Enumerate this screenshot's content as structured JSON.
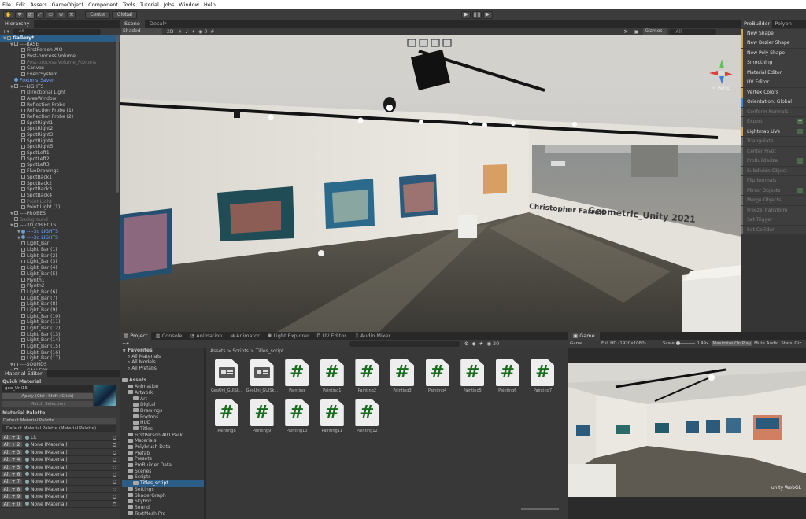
{
  "menu": [
    "File",
    "Edit",
    "Assets",
    "GameObject",
    "Component",
    "Tools",
    "Tutorial",
    "Jobs",
    "Window",
    "Help"
  ],
  "toolbar": {
    "pivot": "Center",
    "space": "Global"
  },
  "hierarchy": {
    "title": "Hierarchy",
    "search": "All",
    "rows": [
      {
        "t": "Gallery*",
        "d": 0,
        "k": "scene"
      },
      {
        "t": "----BASE",
        "d": 1,
        "k": "go"
      },
      {
        "t": "FirstPerson-AIO",
        "d": 2,
        "k": "go"
      },
      {
        "t": "Post-process Volume",
        "d": 2,
        "k": "go"
      },
      {
        "t": "Post-process Volume_Foxtons",
        "d": 2,
        "k": "dim"
      },
      {
        "t": "Canvas",
        "d": 2,
        "k": "go"
      },
      {
        "t": "EventSystem",
        "d": 2,
        "k": "go"
      },
      {
        "t": "Foxtons_Saver",
        "d": 1,
        "k": "blue"
      },
      {
        "t": "----LIGHTS",
        "d": 1,
        "k": "go"
      },
      {
        "t": "Directional Light",
        "d": 2,
        "k": "go"
      },
      {
        "t": "AreaWindow",
        "d": 2,
        "k": "go"
      },
      {
        "t": "Reflection Probe",
        "d": 2,
        "k": "go"
      },
      {
        "t": "Reflection Probe (1)",
        "d": 2,
        "k": "go"
      },
      {
        "t": "Reflection Probe (2)",
        "d": 2,
        "k": "go"
      },
      {
        "t": "SpotRight1",
        "d": 2,
        "k": "go"
      },
      {
        "t": "SpotRight2",
        "d": 2,
        "k": "go"
      },
      {
        "t": "SpotRight3",
        "d": 2,
        "k": "go"
      },
      {
        "t": "SpotRight4",
        "d": 2,
        "k": "go"
      },
      {
        "t": "SpotRight5",
        "d": 2,
        "k": "go"
      },
      {
        "t": "SpotLeft1",
        "d": 2,
        "k": "go"
      },
      {
        "t": "SpotLeft2",
        "d": 2,
        "k": "go"
      },
      {
        "t": "SpotLeft3",
        "d": 2,
        "k": "go"
      },
      {
        "t": "FluoDrawings",
        "d": 2,
        "k": "go"
      },
      {
        "t": "SpotBack1",
        "d": 2,
        "k": "go"
      },
      {
        "t": "SpotBack2",
        "d": 2,
        "k": "go"
      },
      {
        "t": "SpotBack3",
        "d": 2,
        "k": "go"
      },
      {
        "t": "SpotBack4",
        "d": 2,
        "k": "go"
      },
      {
        "t": "Point Light",
        "d": 2,
        "k": "dim"
      },
      {
        "t": "Point Light (1)",
        "d": 2,
        "k": "go"
      },
      {
        "t": "----PROBES",
        "d": 1,
        "k": "go"
      },
      {
        "t": "Background",
        "d": 1,
        "k": "dim"
      },
      {
        "t": "----3D_OBJECTS",
        "d": 1,
        "k": "go"
      },
      {
        "t": "----3d LIGHTS",
        "d": 2,
        "k": "blue"
      },
      {
        "t": "----3d LIGHTS",
        "d": 2,
        "k": "blue"
      },
      {
        "t": "Light_Bar",
        "d": 2,
        "k": "go"
      },
      {
        "t": "Light_Bar (1)",
        "d": 2,
        "k": "go"
      },
      {
        "t": "Light_Bar (2)",
        "d": 2,
        "k": "go"
      },
      {
        "t": "Light_Bar (3)",
        "d": 2,
        "k": "go"
      },
      {
        "t": "Light_Bar (4)",
        "d": 2,
        "k": "go"
      },
      {
        "t": "Light_Bar (5)",
        "d": 2,
        "k": "go"
      },
      {
        "t": "Plynth1",
        "d": 2,
        "k": "go"
      },
      {
        "t": "Plynth2",
        "d": 2,
        "k": "go"
      },
      {
        "t": "Light_Bar (6)",
        "d": 2,
        "k": "go"
      },
      {
        "t": "Light_Bar (7)",
        "d": 2,
        "k": "go"
      },
      {
        "t": "Light_Bar (8)",
        "d": 2,
        "k": "go"
      },
      {
        "t": "Light_Bar (9)",
        "d": 2,
        "k": "go"
      },
      {
        "t": "Light_Bar (10)",
        "d": 2,
        "k": "go"
      },
      {
        "t": "Light_Bar (11)",
        "d": 2,
        "k": "go"
      },
      {
        "t": "Light_Bar (12)",
        "d": 2,
        "k": "go"
      },
      {
        "t": "Light_Bar (13)",
        "d": 2,
        "k": "go"
      },
      {
        "t": "Light_Bar (14)",
        "d": 2,
        "k": "go"
      },
      {
        "t": "Light_Bar (15)",
        "d": 2,
        "k": "go"
      },
      {
        "t": "Light_Bar (16)",
        "d": 2,
        "k": "go"
      },
      {
        "t": "Light_Bar (17)",
        "d": 2,
        "k": "go"
      },
      {
        "t": "----SOUNDS",
        "d": 1,
        "k": "go"
      },
      {
        "t": "----GALLERY",
        "d": 1,
        "k": "go"
      }
    ]
  },
  "material_editor": {
    "title": "Material Editor",
    "quick": "Quick Material",
    "mat": "geo_Uni15",
    "apply": "Apply (Ctrl+Shift+Click)",
    "match": "Match Selection",
    "palette": "Material Palette",
    "palette_sel": "Default Material Palette",
    "palette_name": "Default Material Palette (Material Palette)",
    "rows": [
      {
        "alt": "Alt + 1",
        "name": "Lit"
      },
      {
        "alt": "Alt + 2",
        "name": "None (Material)"
      },
      {
        "alt": "Alt + 3",
        "name": "None (Material)"
      },
      {
        "alt": "Alt + 4",
        "name": "None (Material)"
      },
      {
        "alt": "Alt + 5",
        "name": "None (Material)"
      },
      {
        "alt": "Alt + 6",
        "name": "None (Material)"
      },
      {
        "alt": "Alt + 7",
        "name": "None (Material)"
      },
      {
        "alt": "Alt + 8",
        "name": "None (Material)"
      },
      {
        "alt": "Alt + 9",
        "name": "None (Material)"
      },
      {
        "alt": "Alt + 0",
        "name": "None (Material)"
      }
    ]
  },
  "scene": {
    "tab1": "Scene",
    "tab2": "Decal*",
    "shading": "Shaded",
    "mode2d": "2D",
    "gizmos": "Gizmos",
    "search": "All",
    "persp": "< Persp",
    "count": "0",
    "watermark1": "Christopher Farrell",
    "watermark2": "Geometric_Unity 2021"
  },
  "probuilder": {
    "tab1": "ProBuilder",
    "tab2": "Polybn",
    "items": [
      {
        "t": "New Shape",
        "s": "n"
      },
      {
        "t": "New Bezier Shape",
        "s": "n"
      },
      {
        "t": "New Poly Shape",
        "s": "n"
      },
      {
        "t": "Smoothing",
        "s": "n"
      },
      {
        "t": "Material Editor",
        "s": "n"
      },
      {
        "t": "UV Editor",
        "s": "n"
      },
      {
        "t": "Vertex Colors",
        "s": "n"
      },
      {
        "t": "Orientation: Global",
        "s": "b"
      },
      {
        "t": "Conform Normals",
        "s": "d"
      },
      {
        "t": "Export",
        "s": "d",
        "p": 1
      },
      {
        "t": "Lightmap UVs",
        "s": "n",
        "p": 1
      },
      {
        "t": "Triangulate",
        "s": "d"
      },
      {
        "t": "Center Pivot",
        "s": "d"
      },
      {
        "t": "ProBuilderize",
        "s": "d",
        "p": 1
      },
      {
        "t": "Subdivide Object",
        "s": "d"
      },
      {
        "t": "Flip Normals",
        "s": "d"
      },
      {
        "t": "Mirror Objects",
        "s": "d",
        "p": 1
      },
      {
        "t": "Merge Objects",
        "s": "d"
      },
      {
        "t": "Freeze Transform",
        "s": "d"
      },
      {
        "t": "Set Trigger",
        "s": "d"
      },
      {
        "t": "Set Collider",
        "s": "d"
      }
    ]
  },
  "project": {
    "tabs": [
      "Project",
      "Console",
      "Animation",
      "Animator",
      "Light Explorer",
      "UV Editor",
      "Audio Mixer"
    ],
    "path": [
      "Assets",
      ">",
      "Scripts",
      ">",
      "Titles_script"
    ],
    "count": "20",
    "tree": [
      {
        "t": "Favorites",
        "d": 0,
        "k": "star"
      },
      {
        "t": "All Materials",
        "d": 1,
        "k": "search"
      },
      {
        "t": "All Models",
        "d": 1,
        "k": "search"
      },
      {
        "t": "All Prefabs",
        "d": 1,
        "k": "search"
      },
      {
        "t": "",
        "d": 0,
        "k": "gap"
      },
      {
        "t": "Assets",
        "d": 0,
        "k": "folder"
      },
      {
        "t": "Animation",
        "d": 1,
        "k": "folder"
      },
      {
        "t": "Artwork",
        "d": 1,
        "k": "folder"
      },
      {
        "t": "Art",
        "d": 2,
        "k": "folder"
      },
      {
        "t": "Digital",
        "d": 2,
        "k": "folder"
      },
      {
        "t": "Drawings",
        "d": 2,
        "k": "folder"
      },
      {
        "t": "Foxtons",
        "d": 2,
        "k": "folder"
      },
      {
        "t": "HUD",
        "d": 2,
        "k": "folder"
      },
      {
        "t": "Titles",
        "d": 2,
        "k": "folder"
      },
      {
        "t": "FirstPerson AIO Pack",
        "d": 1,
        "k": "folder"
      },
      {
        "t": "Materials",
        "d": 1,
        "k": "folder"
      },
      {
        "t": "Polybrush Data",
        "d": 1,
        "k": "folder"
      },
      {
        "t": "Prefab",
        "d": 1,
        "k": "folder"
      },
      {
        "t": "Presets",
        "d": 1,
        "k": "folder"
      },
      {
        "t": "ProBuilder Data",
        "d": 1,
        "k": "folder"
      },
      {
        "t": "Scenes",
        "d": 1,
        "k": "folder"
      },
      {
        "t": "Scripts",
        "d": 1,
        "k": "folder"
      },
      {
        "t": "Titles_script",
        "d": 2,
        "k": "sel"
      },
      {
        "t": "Settings",
        "d": 1,
        "k": "folder"
      },
      {
        "t": "ShaderGraph",
        "d": 1,
        "k": "folder"
      },
      {
        "t": "Skybox",
        "d": 1,
        "k": "folder"
      },
      {
        "t": "Sound",
        "d": 1,
        "k": "folder"
      },
      {
        "t": "TextMesh Pro",
        "d": 1,
        "k": "folder"
      }
    ],
    "assets": [
      {
        "t": "GeoUni_GUISk...",
        "g": 1
      },
      {
        "t": "GeoUni_GUISk...",
        "g": 1
      },
      {
        "t": "Painting"
      },
      {
        "t": "Painting1"
      },
      {
        "t": "Painting2"
      },
      {
        "t": "Painting3"
      },
      {
        "t": "Painting4"
      },
      {
        "t": "Painting5"
      },
      {
        "t": "Painting6"
      },
      {
        "t": "Painting7"
      },
      {
        "t": "Painting8"
      },
      {
        "t": "Painting9"
      },
      {
        "t": "Painting10"
      },
      {
        "t": "Painting11"
      },
      {
        "t": "Painting12"
      }
    ]
  },
  "game": {
    "tab": "Game",
    "display": "Game",
    "res": "Full HD (1920x1080)",
    "scale_label": "Scale",
    "scale": "0.49x",
    "max": "Maximize On Play",
    "mute": "Mute Audio",
    "stats": "Stats",
    "gizmos": "Giz",
    "badge": "unity WebGL"
  },
  "colors": {
    "accent": "#2c5d87",
    "probuilder": "#c9a45a",
    "bg": "#383838"
  }
}
